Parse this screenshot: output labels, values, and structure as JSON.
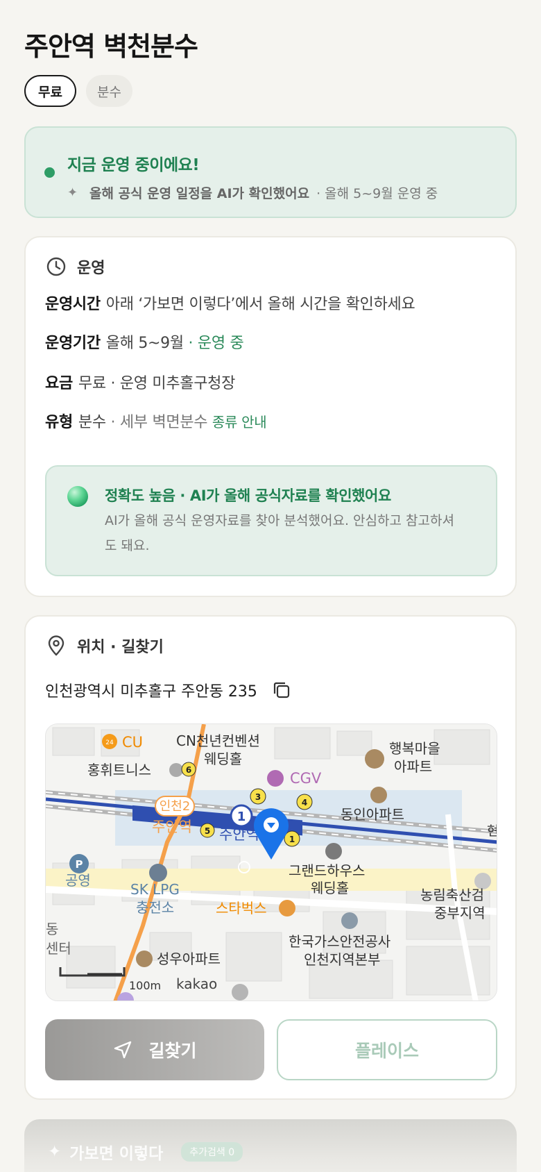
{
  "header": {
    "title": "주안역 벽천분수",
    "chips": [
      "무료",
      "분수"
    ]
  },
  "status": {
    "title": "지금 운영 중이에요!",
    "ai_note": "올해 공식 운영 일정을 AI가 확인했어요",
    "period_note": "· 올해 5~9월 운영 중"
  },
  "operation": {
    "section_title": "운영",
    "hours_key": "운영시간",
    "hours_value": "아래 ‘가보면 이렇다’에서 올해 시간을 확인하세요",
    "period_key": "운영기간",
    "period_value": "올해 5~9월",
    "period_status": "· 운영 중",
    "fee_key": "요금",
    "fee_value": "무료 · 운영 미추홀구청장",
    "type_key": "유형",
    "type_value": "분수",
    "type_detail": "· 세부 벽면분수",
    "type_link": "종류 안내",
    "accuracy_title": "정확도 높음 · AI가 올해 공식자료를 확인했어요",
    "accuracy_body": "AI가 올해 공식 운영자료를 찾아 분석했어요. 안심하고 참고하셔도 돼요."
  },
  "location": {
    "section_title": "위치 · 길찾기",
    "address": "인천광역시 미추홀구 주안동 235",
    "map": {
      "labels": {
        "cu": "CU",
        "cn1": "CN천년컨벤션",
        "cn2": "웨딩홀",
        "happy1": "행복마을",
        "happy2": "아파트",
        "hongwi": "홍휘트니스",
        "cgv": "CGV",
        "incheon2": "인천2",
        "juan_orange": "주안역",
        "juan_blue": "주안역",
        "dongin": "동인아파트",
        "grand1": "그랜드하우스",
        "grand2": "웨딩홀",
        "gongyeong": "공영",
        "sk1": "SK LPG",
        "sk2": "충전소",
        "starbucks": "스타벅스",
        "nonglim1": "농림축산검",
        "nonglim2": "중부지역",
        "gas1": "한국가스안전공사",
        "gas2": "인천지역본부",
        "dong": "동",
        "center": "센터",
        "seongwoo": "성우아파트",
        "scale": "100m",
        "kakao": "kakao",
        "edge": "현"
      }
    },
    "directions_label": "길찾기",
    "place_label": "플레이스"
  },
  "next_section": {
    "title": "가보면 이렇다",
    "badge": "추가검색 0"
  },
  "colors": {
    "accent_green": "#2e9d66",
    "status_bg": "#e5f0ea",
    "subway_blue": "#2f4fb0",
    "incheon_orange": "#f5a04a",
    "pin_blue": "#1a73e8"
  }
}
